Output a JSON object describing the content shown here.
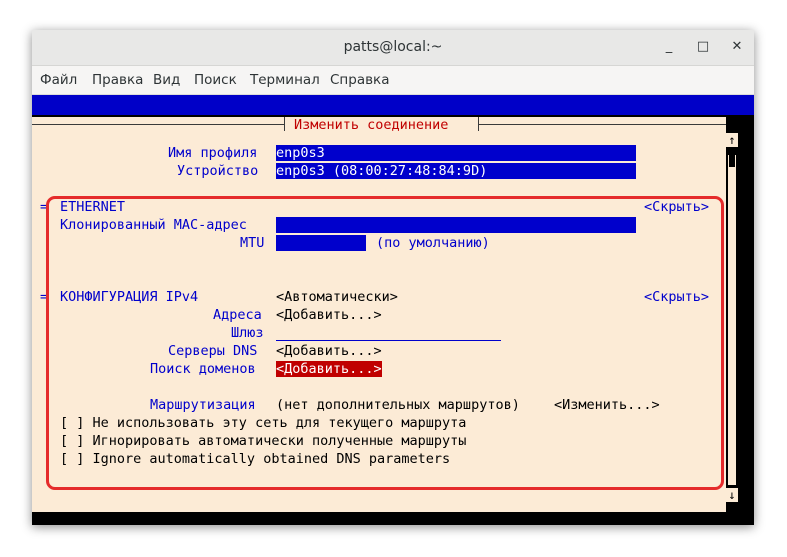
{
  "window": {
    "title": "patts@local:~",
    "buttons": [
      "_",
      "□",
      "✕"
    ]
  },
  "menu": [
    "Файл",
    "Правка",
    "Вид",
    "Поиск",
    "Терминал",
    "Справка"
  ],
  "dialog": {
    "title": "Изменить соединение",
    "profile_label": "Имя профиля",
    "profile_value": "enp0s3",
    "device_label": "Устройство",
    "device_value": "enp0s3 (08:00:27:48:84:9D)",
    "ethernet": {
      "marker": "=",
      "heading": "ETHERNET",
      "hide": "<Скрыть>",
      "mac_label": "Клонированный MAC-адрес",
      "mac_value": "",
      "mtu_label": "MTU",
      "mtu_value": "",
      "mtu_hint": "(по умолчанию)"
    },
    "ipv4": {
      "marker": "=",
      "heading": "КОНФИГУРАЦИЯ IPv4",
      "mode": "<Автоматически>",
      "hide": "<Скрыть>",
      "addresses_label": "Адреса",
      "addresses_value": "<Добавить...>",
      "gateway_label": "Шлюз",
      "gateway_value": "",
      "dns_label": "Серверы DNS",
      "dns_value": "<Добавить...>",
      "search_label": "Поиск доменов",
      "search_value": "<Добавить...>",
      "routing_label": "Маршрутизация",
      "routing_value": "(нет дополнительных маршрутов)",
      "routing_edit": "<Изменить...>",
      "opt1": "[ ] Не использовать эту сеть для текущего маршрута",
      "opt2": "[ ] Игнорировать автоматически полученные маршруты",
      "opt3": "[ ] Ignore automatically obtained DNS parameters"
    }
  },
  "scrollbar": {
    "up": "↑",
    "down": "↓"
  },
  "colors": {
    "terminal_bg": "#fcebd6",
    "field_bg": "#0000cc",
    "selected_bg": "#c00000",
    "text": "#0000cc",
    "callout": "#e52b2b"
  }
}
